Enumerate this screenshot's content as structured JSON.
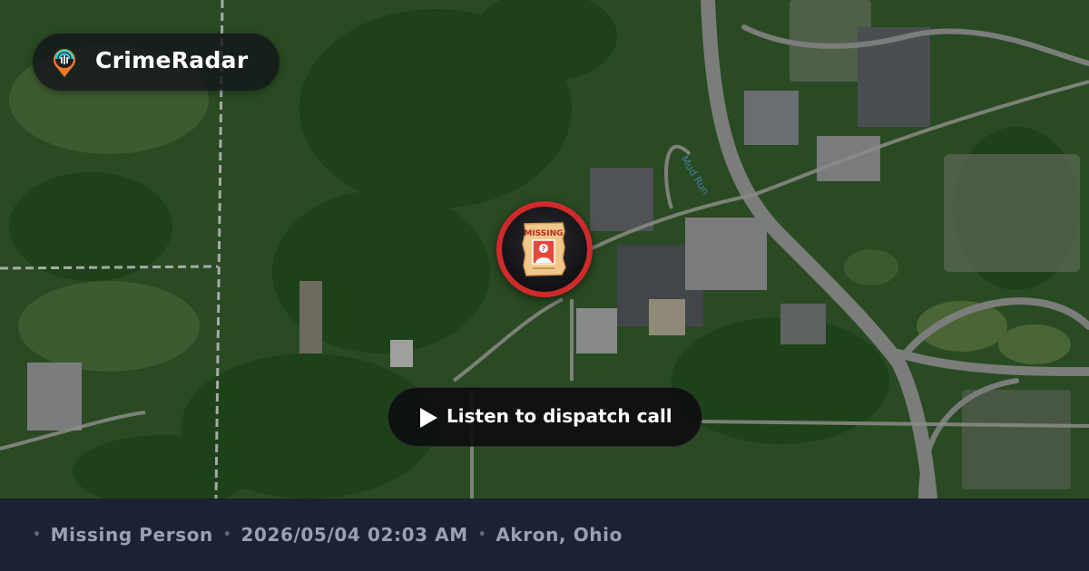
{
  "brand": {
    "name": "CrimeRadar",
    "logo_icon": "radar-pin-icon"
  },
  "marker": {
    "icon": "missing-poster-icon",
    "poster_text": "MISSING",
    "ring_color": "#d02a2a"
  },
  "action": {
    "label": "Listen to dispatch call",
    "icon": "play-icon"
  },
  "footer": {
    "separator": "•",
    "category": "Missing Person",
    "datetime": "2026/05/04 02:03 AM",
    "location": "Akron, Ohio"
  },
  "map": {
    "style": "satellite",
    "stream_label": "Mud Run"
  }
}
